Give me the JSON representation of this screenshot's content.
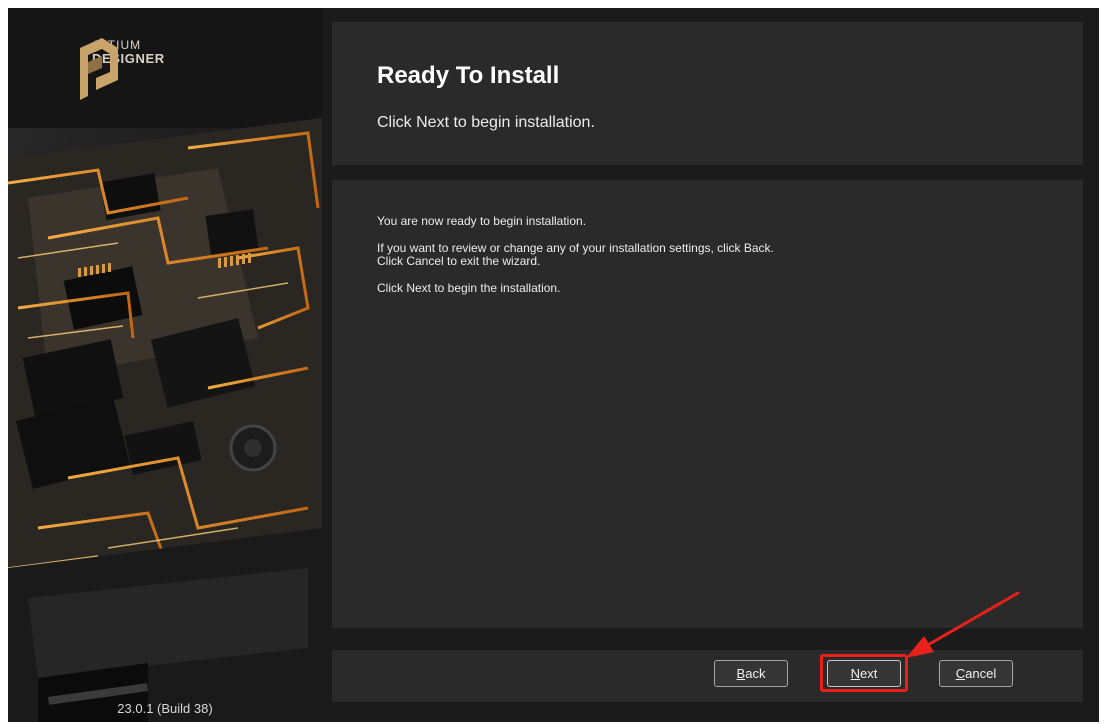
{
  "brand": {
    "line1": "ALTIUM",
    "line2": "DESIGNER",
    "gold": "#c9a46a"
  },
  "version": "23.0.1 (Build 38)",
  "header": {
    "title": "Ready To Install",
    "subtitle": "Click Next to begin installation."
  },
  "content": {
    "paragraph1": "You are now ready to begin installation.",
    "paragraph2_line1": "If you want to review or change any of your installation settings, click Back.",
    "paragraph2_line2": "Click Cancel to exit the wizard.",
    "paragraph3": "Click Next to begin the installation."
  },
  "buttons": {
    "back": {
      "first": "B",
      "rest": "ack"
    },
    "next": {
      "first": "N",
      "rest": "ext"
    },
    "cancel": {
      "first": "C",
      "rest": "ancel"
    }
  },
  "annotation": {
    "highlight_color": "#e8211c",
    "arrow_icon": "red-arrow-icon"
  }
}
